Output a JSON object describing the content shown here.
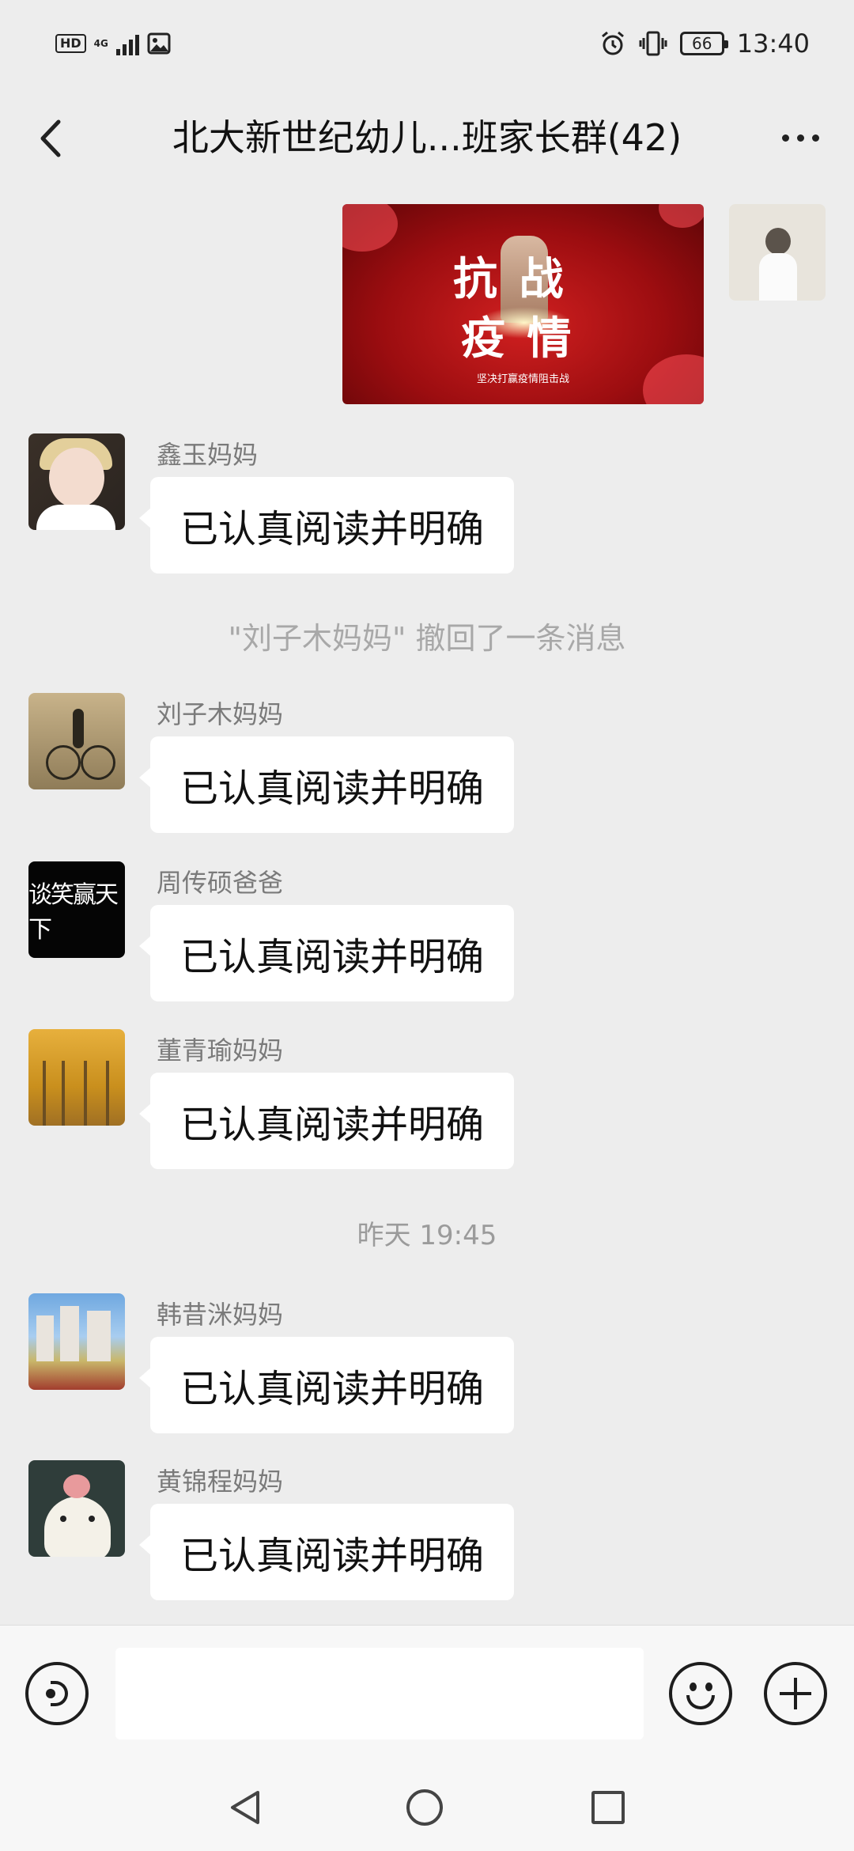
{
  "status_bar": {
    "hd_label": "HD",
    "network_label": "4G",
    "time": "13:40",
    "battery": "66"
  },
  "nav": {
    "title": "北大新世纪幼儿...班家长群(42)"
  },
  "image_message": {
    "line1": "抗 战",
    "line2": "疫 情",
    "caption": "坚决打赢疫情阻击战"
  },
  "messages": [
    {
      "sender": "鑫玉妈妈",
      "text": "已认真阅读并明确"
    },
    {
      "sender": "刘子木妈妈",
      "text": "已认真阅读并明确"
    },
    {
      "sender": "周传硕爸爸",
      "text": "已认真阅读并明确"
    },
    {
      "sender": "董青瑜妈妈",
      "text": "已认真阅读并明确"
    },
    {
      "sender": "韩昔洣妈妈",
      "text": "已认真阅读并明确"
    },
    {
      "sender": "黄锦程妈妈",
      "text": "已认真阅读并明确"
    }
  ],
  "avatar_text": "谈笑赢天下",
  "system_messages": {
    "recall": "\"刘子木妈妈\" 撤回了一条消息",
    "timestamp": "昨天 19:45"
  },
  "input": {
    "value": ""
  }
}
